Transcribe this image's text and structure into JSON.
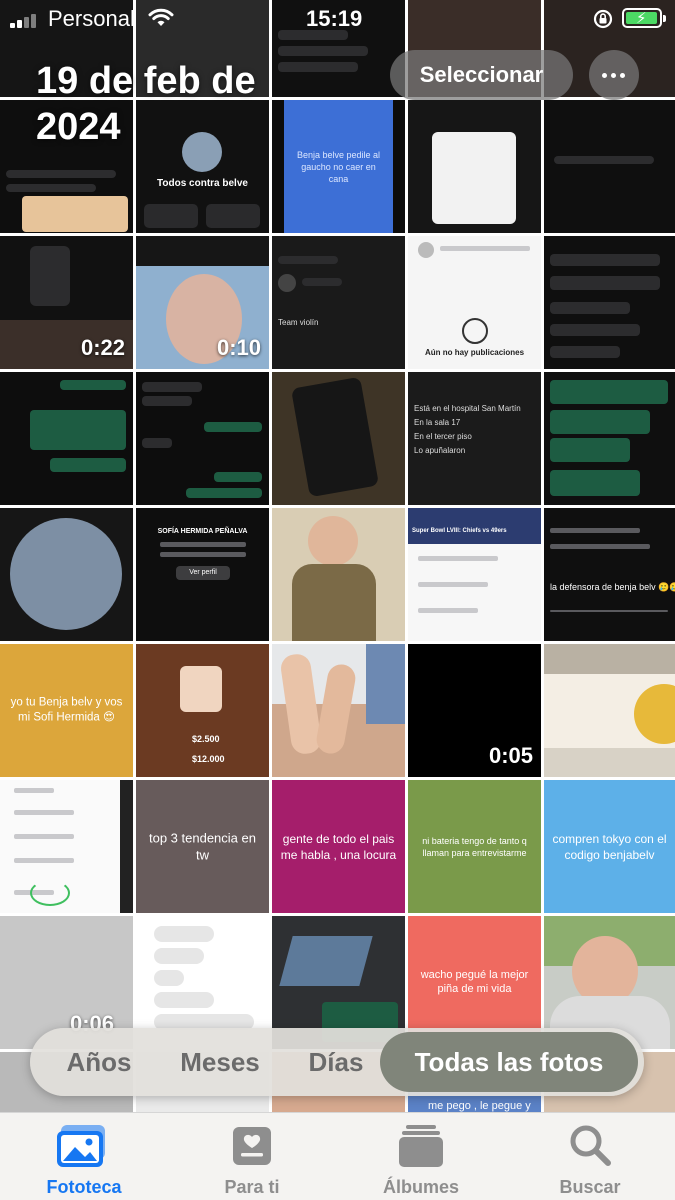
{
  "status_bar": {
    "carrier": "Personal",
    "time": "15:19",
    "battery_level": 0.85
  },
  "header": {
    "date": "19 de feb de 2024",
    "select_label": "Seleccionar",
    "more_icon": "ellipsis-icon"
  },
  "tiles": {
    "t1": "Todos contra belve",
    "t2": "Benja belve pedile al gaucho no caer en cana",
    "d1": "0:22",
    "d2": "0:10",
    "t3": "Aún no hay publicaciones",
    "t4": "Team violín",
    "t5": "yo tu Benja belv y vos mi Sofi Hermida 😍",
    "t6": "la defensora de benja belv 🥲🥲",
    "t7": "$2.500",
    "t8": "$12.000",
    "d3": "0:05",
    "t9": "top 3 tendencia en tw",
    "t10": "gente de todo el pais me habla , una locura",
    "t11": "ni bateria tengo de tanto q llaman para entrevistarme",
    "t12": "compren tokyo con el codigo benjabelv",
    "t13": "wacho pegué la mejor piña de mi vida",
    "t14": "me pego , le pegue y",
    "t15": "Ver perfil",
    "t16": "Está en el hospital San Martín",
    "t17": "En la sala 17",
    "t18": "En el tercer piso",
    "t19": "Lo apuñalaron",
    "t20": "Super Bowl LVIII: Chiefs vs 49ers",
    "t21": "SOFÍA HERMIDA PEÑALVA",
    "d4": "0:06"
  },
  "segmented": {
    "options": [
      "Años",
      "Meses",
      "Días",
      "Todas las fotos"
    ],
    "selected": "Todas las fotos"
  },
  "tabbar": {
    "items": [
      {
        "label": "Fototeca",
        "icon": "photo-library-icon",
        "active": true
      },
      {
        "label": "Para ti",
        "icon": "for-you-icon",
        "active": false
      },
      {
        "label": "Álbumes",
        "icon": "albums-icon",
        "active": false
      },
      {
        "label": "Buscar",
        "icon": "search-icon",
        "active": false
      }
    ]
  },
  "colors": {
    "accent": "#1677f2",
    "segment_active": "#80857a"
  }
}
